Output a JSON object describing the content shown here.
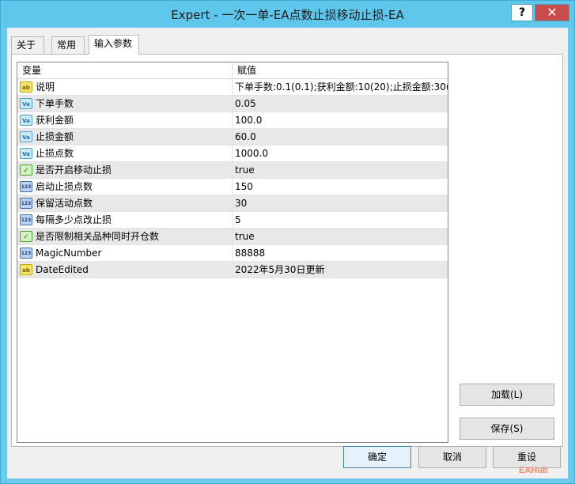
{
  "window": {
    "title": "Expert - 一次一单-EA点数止损移动止损-EA",
    "help": "?",
    "close": "✕"
  },
  "tabs": [
    {
      "label": "关于"
    },
    {
      "label": "常用"
    },
    {
      "label": "输入参数"
    }
  ],
  "grid": {
    "col_variable": "变量",
    "col_value": "赋值",
    "rows": [
      {
        "icon": "ab",
        "name": "说明",
        "value": "下单手数:0.1(0.1);获利金额:10(20);止损金额:30(..."
      },
      {
        "icon": "Va",
        "name": "下单手数",
        "value": "0.05"
      },
      {
        "icon": "Va",
        "name": "获利金额",
        "value": "100.0"
      },
      {
        "icon": "Va",
        "name": "止损金额",
        "value": "60.0"
      },
      {
        "icon": "Va",
        "name": "止损点数",
        "value": "1000.0"
      },
      {
        "icon": "✓",
        "name": "是否开启移动止损",
        "value": "true"
      },
      {
        "icon": "123",
        "name": "启动止损点数",
        "value": "150"
      },
      {
        "icon": "123",
        "name": "保留活动点数",
        "value": "30"
      },
      {
        "icon": "123",
        "name": "每隔多少点改止损",
        "value": "5"
      },
      {
        "icon": "✓",
        "name": "是否限制相关品种同时开仓数",
        "value": "true"
      },
      {
        "icon": "123",
        "name": "MagicNumber",
        "value": "88888"
      },
      {
        "icon": "ab",
        "name": "DateEdited",
        "value": "2022年5月30日更新"
      }
    ]
  },
  "buttons": {
    "load": "加载(L)",
    "save": "保存(S)",
    "ok": "确定",
    "cancel": "取消",
    "reset": "重设"
  },
  "watermark": "EAHub"
}
